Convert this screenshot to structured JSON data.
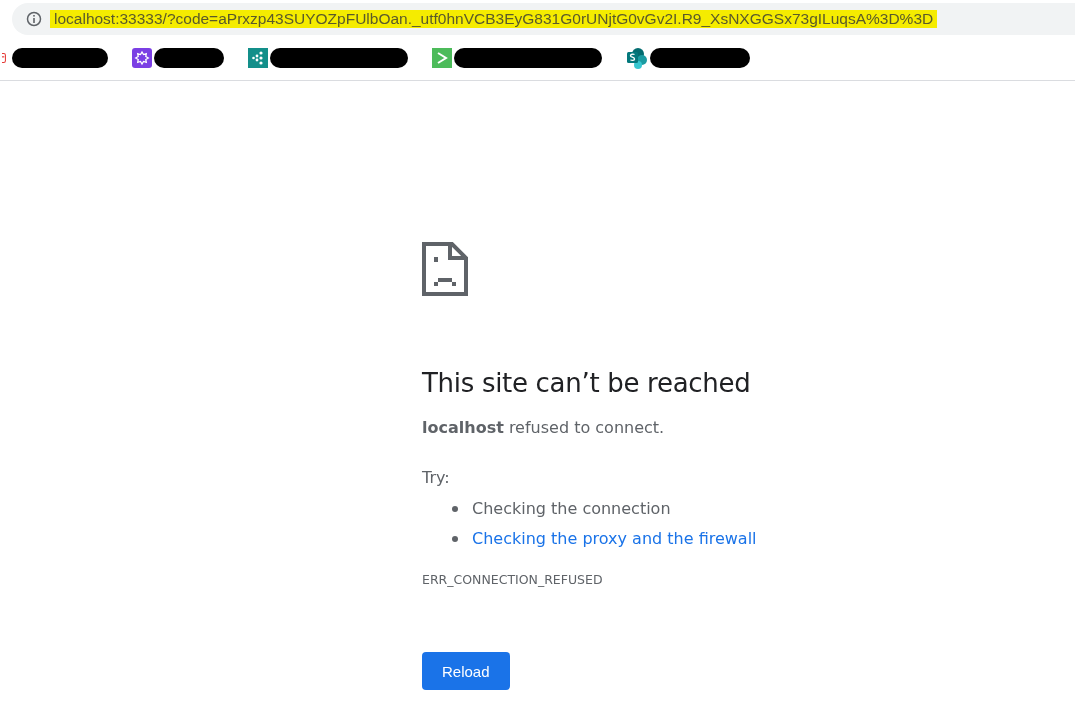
{
  "address_bar": {
    "url": "localhost:33333/?code=aPrxzp43SUYOZpFUlbOan._utf0hnVCB3EyG831G0rUNjtG0vGv2I.R9_XsNXGGSx73gILuqsA%3D%3D",
    "highlighted": true
  },
  "bookmarks": [
    {
      "kind": "red",
      "redacted": true
    },
    {
      "kind": "purple",
      "redacted": true
    },
    {
      "kind": "teal",
      "redacted": true
    },
    {
      "kind": "green",
      "redacted": true
    },
    {
      "kind": "sharepoint",
      "redacted": true
    }
  ],
  "error": {
    "title": "This site can’t be reached",
    "message": "**localhost** refused to connect.",
    "try_label": "Try:",
    "suggestions": [
      {
        "text": "Checking the connection",
        "link": false
      },
      {
        "text": "Checking the proxy and the firewall",
        "link": true
      }
    ],
    "code": "ERR_CONNECTION_REFUSED",
    "button": "Reload"
  }
}
